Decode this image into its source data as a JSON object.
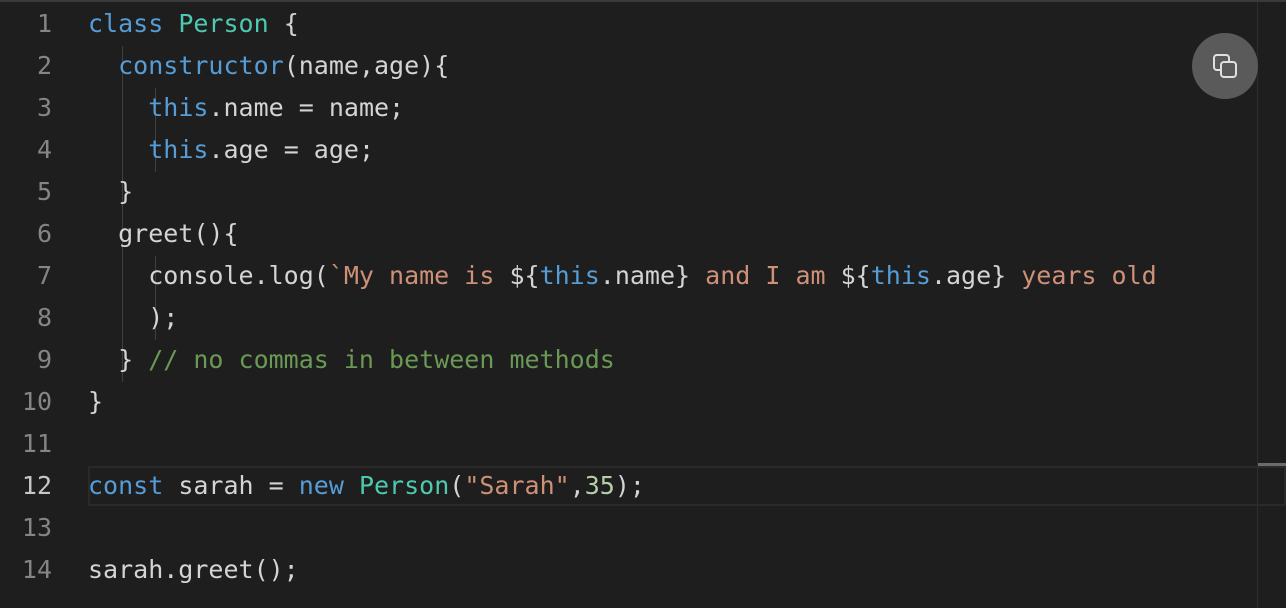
{
  "editor": {
    "active_line": 12,
    "line_numbers": [
      "1",
      "2",
      "3",
      "4",
      "5",
      "6",
      "7",
      "8",
      "9",
      "10",
      "11",
      "12",
      "13",
      "14"
    ],
    "lines": [
      [
        {
          "t": "kw",
          "v": "class"
        },
        {
          "t": "plain",
          "v": " "
        },
        {
          "t": "cls",
          "v": "Person"
        },
        {
          "t": "plain",
          "v": " {"
        }
      ],
      [
        {
          "t": "plain",
          "v": "  "
        },
        {
          "t": "kw",
          "v": "constructor"
        },
        {
          "t": "plain",
          "v": "(name,age){"
        }
      ],
      [
        {
          "t": "plain",
          "v": "    "
        },
        {
          "t": "kw",
          "v": "this"
        },
        {
          "t": "plain",
          "v": ".name = name;"
        }
      ],
      [
        {
          "t": "plain",
          "v": "    "
        },
        {
          "t": "kw",
          "v": "this"
        },
        {
          "t": "plain",
          "v": ".age = age;"
        }
      ],
      [
        {
          "t": "plain",
          "v": "  }"
        }
      ],
      [
        {
          "t": "plain",
          "v": "  greet(){"
        }
      ],
      [
        {
          "t": "plain",
          "v": "    console.log("
        },
        {
          "t": "str",
          "v": "`My name is "
        },
        {
          "t": "plain",
          "v": "${"
        },
        {
          "t": "kw",
          "v": "this"
        },
        {
          "t": "plain",
          "v": ".name}"
        },
        {
          "t": "str",
          "v": " and I am "
        },
        {
          "t": "plain",
          "v": "${"
        },
        {
          "t": "kw",
          "v": "this"
        },
        {
          "t": "plain",
          "v": ".age}"
        },
        {
          "t": "str",
          "v": " years old"
        }
      ],
      [
        {
          "t": "plain",
          "v": "    );"
        }
      ],
      [
        {
          "t": "plain",
          "v": "  } "
        },
        {
          "t": "cmt",
          "v": "// no commas in between methods"
        }
      ],
      [
        {
          "t": "plain",
          "v": "}"
        }
      ],
      [],
      [
        {
          "t": "kw",
          "v": "const"
        },
        {
          "t": "plain",
          "v": " sarah = "
        },
        {
          "t": "kw",
          "v": "new"
        },
        {
          "t": "plain",
          "v": " "
        },
        {
          "t": "cls",
          "v": "Person"
        },
        {
          "t": "plain",
          "v": "("
        },
        {
          "t": "str",
          "v": "\"Sarah\""
        },
        {
          "t": "plain",
          "v": ","
        },
        {
          "t": "num",
          "v": "35"
        },
        {
          "t": "plain",
          "v": ");"
        }
      ],
      [],
      [
        {
          "t": "plain",
          "v": "sarah.greet();"
        }
      ]
    ]
  },
  "copy_button": {
    "icon": "copy-icon"
  }
}
